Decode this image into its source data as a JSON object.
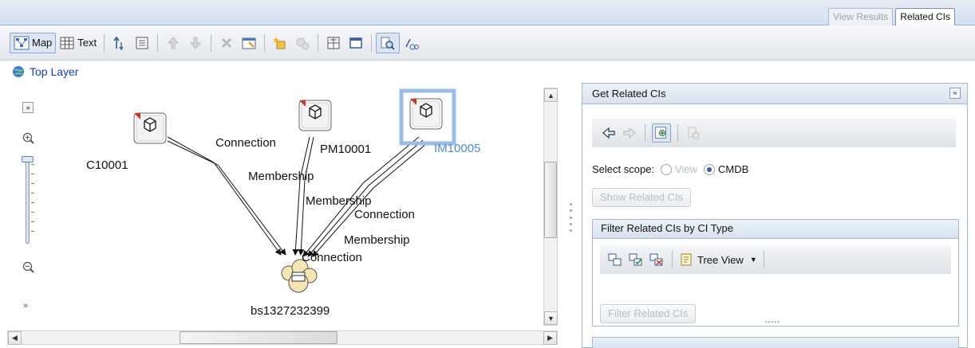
{
  "tabs": {
    "view_results": "View Results",
    "related_cis": "Related CIs"
  },
  "toolbar": {
    "map_label": "Map",
    "text_label": "Text"
  },
  "breadcrumb": {
    "top_layer": "Top Layer"
  },
  "map": {
    "nodes": {
      "c10001": "C10001",
      "pm10001": "PM10001",
      "im10005": "IM10005",
      "bs": "bs1327232399"
    },
    "relations": {
      "connection1": "Connection",
      "membership1": "Membership",
      "membership2": "Membership",
      "connection2": "Connection",
      "membership3": "Membership",
      "connection3": "Connection"
    }
  },
  "panel": {
    "title": "Get Related CIs",
    "select_scope_label": "Select scope:",
    "scope_view": "View",
    "scope_cmdb": "CMDB",
    "scope_selected": "CMDB",
    "show_related_button": "Show Related CIs",
    "filter": {
      "title": "Filter Related CIs by CI Type",
      "tree_view_label": "Tree View",
      "filter_button": "Filter Related CIs"
    }
  },
  "colors": {
    "selection": "#9cbde6",
    "link": "#1a3fbf",
    "accent": "#2f5fa8"
  }
}
